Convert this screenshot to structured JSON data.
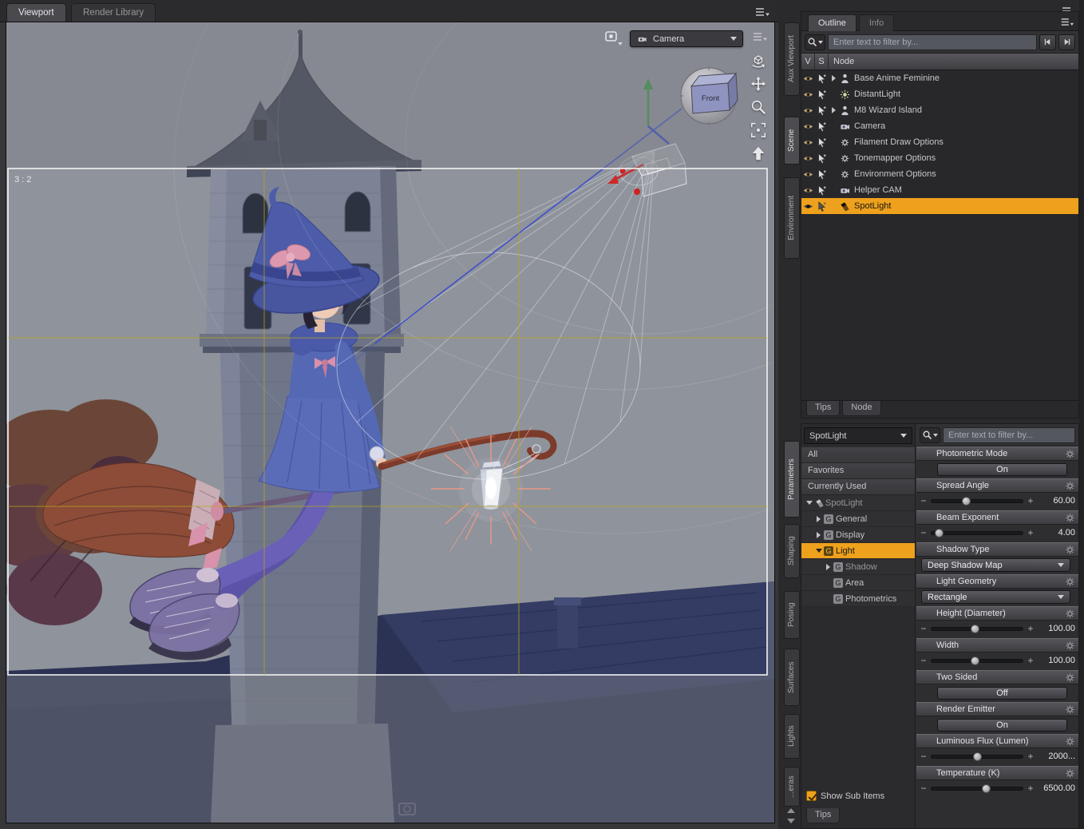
{
  "window": {
    "tabs": [
      {
        "label": "Viewport",
        "active": true
      },
      {
        "label": "Render Library",
        "active": false
      }
    ]
  },
  "viewport": {
    "aspect_label": "3 : 2",
    "camera_selector_label": "Camera",
    "nav_cube_face": "Front"
  },
  "dock_tabs": {
    "top": [
      {
        "label": "Aux Viewport",
        "active": false
      },
      {
        "label": "Scene",
        "active": true
      },
      {
        "label": "Environment",
        "active": false
      }
    ],
    "bottom": [
      {
        "label": "Parameters",
        "active": true
      },
      {
        "label": "Shaping",
        "active": false
      },
      {
        "label": "Posing",
        "active": false
      },
      {
        "label": "Surfaces",
        "active": false
      },
      {
        "label": "Lights",
        "active": false
      },
      {
        "label": "...eras",
        "active": false
      }
    ]
  },
  "scene_panel": {
    "tabs": [
      {
        "label": "Outline",
        "active": true
      },
      {
        "label": "Info",
        "active": false
      }
    ],
    "filter_placeholder": "Enter text to filter by...",
    "columns": {
      "v": "V",
      "s": "S",
      "node": "Node"
    },
    "nodes": [
      {
        "label": "Base Anime Feminine",
        "expandable": true,
        "selected": false
      },
      {
        "label": "DistantLight",
        "expandable": false,
        "selected": false
      },
      {
        "label": "M8 Wizard Island",
        "expandable": true,
        "selected": false
      },
      {
        "label": "Camera",
        "expandable": false,
        "selected": false
      },
      {
        "label": "Filament Draw Options",
        "expandable": false,
        "selected": false
      },
      {
        "label": "Tonemapper Options",
        "expandable": false,
        "selected": false
      },
      {
        "label": "Environment Options",
        "expandable": false,
        "selected": false
      },
      {
        "label": "Helper CAM",
        "expandable": false,
        "selected": false
      },
      {
        "label": "SpotLight",
        "expandable": false,
        "selected": true
      }
    ],
    "bottom_tabs": [
      {
        "label": "Tips"
      },
      {
        "label": "Node"
      }
    ]
  },
  "parameters_panel": {
    "node_selector": "SpotLight",
    "lists": [
      {
        "label": "All"
      },
      {
        "label": "Favorites"
      },
      {
        "label": "Currently Used"
      }
    ],
    "tree": [
      {
        "label": "SpotLight",
        "level": 0
      },
      {
        "label": "General",
        "level": 1
      },
      {
        "label": "Display",
        "level": 1
      },
      {
        "label": "Light",
        "level": 1,
        "selected": true
      },
      {
        "label": "Shadow",
        "level": 2
      },
      {
        "label": "Area",
        "level": 2
      },
      {
        "label": "Photometrics",
        "level": 2
      }
    ],
    "filter_placeholder": "Enter text to filter by...",
    "properties": [
      {
        "label": "Photometric Mode",
        "type": "toggle",
        "value": "On"
      },
      {
        "label": "Spread Angle",
        "type": "slider",
        "value": "60.00",
        "knob_pct": 38
      },
      {
        "label": "Beam Exponent",
        "type": "slider",
        "value": "4.00",
        "knob_pct": 8
      },
      {
        "label": "Shadow Type",
        "type": "dropdown",
        "value": "Deep Shadow Map"
      },
      {
        "label": "Light Geometry",
        "type": "dropdown",
        "value": "Rectangle"
      },
      {
        "label": "Height (Diameter)",
        "type": "slider",
        "value": "100.00",
        "knob_pct": 47
      },
      {
        "label": "Width",
        "type": "slider",
        "value": "100.00",
        "knob_pct": 47
      },
      {
        "label": "Two Sided",
        "type": "toggle",
        "value": "Off"
      },
      {
        "label": "Render Emitter",
        "type": "toggle",
        "value": "On"
      },
      {
        "label": "Luminous Flux (Lumen)",
        "type": "slider",
        "value": "2000...",
        "knob_pct": 50
      },
      {
        "label": "Temperature (K)",
        "type": "slider",
        "value": "6500.00",
        "knob_pct": 60
      }
    ],
    "show_sub_items_label": "Show Sub Items",
    "bottom_tab": "Tips"
  },
  "colors": {
    "highlight": "#eea11c",
    "selection_text": "#161616",
    "frame_border": "#f2f2f2",
    "guide_yellow": "#b6a61e",
    "wireframe_blue": "#3a4cd0"
  }
}
